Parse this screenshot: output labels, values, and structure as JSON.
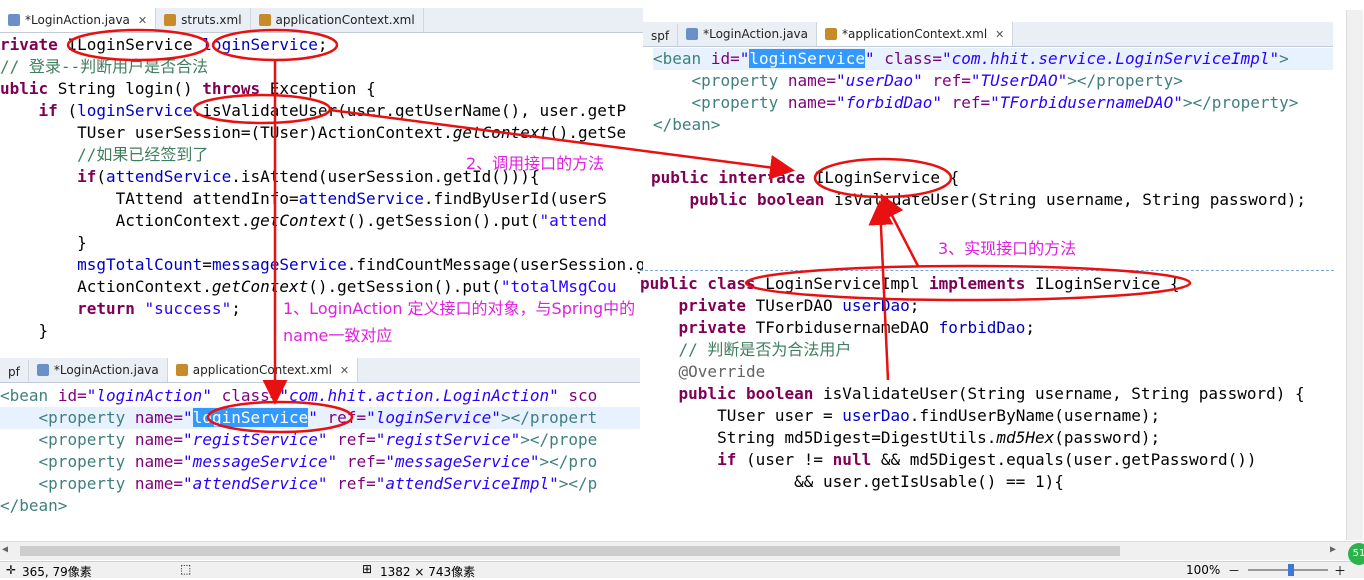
{
  "left_editor": {
    "tabs": [
      {
        "label": "*LoginAction.java",
        "close": "✕",
        "icon": "java-file-icon"
      },
      {
        "label": "struts.xml",
        "icon": "xml-file-icon"
      },
      {
        "label": "applicationContext.xml",
        "icon": "xml-file-icon"
      }
    ],
    "lines": [
      [
        [
          "rivate ",
          "kw"
        ],
        [
          "ILoginService ",
          ""
        ],
        [
          "loginService",
          "fd"
        ],
        [
          ";",
          ""
        ]
      ],
      [
        [
          "// 登录--判断用户是否合法",
          "cm"
        ]
      ],
      [
        [
          "ublic ",
          "kw"
        ],
        [
          "String login() ",
          ""
        ],
        [
          "throws ",
          "kw"
        ],
        [
          "Exception {",
          ""
        ]
      ],
      [
        [
          "    if ",
          "kw"
        ],
        [
          "(",
          ""
        ],
        [
          "loginService",
          "fd"
        ],
        [
          ".isValidateUser(user.getUserName(), user.getP",
          ""
        ]
      ],
      [
        [
          "        TUser userSession=(TUser)ActionContext.",
          ""
        ],
        [
          "getContext",
          "it"
        ],
        [
          "().getSe",
          ""
        ]
      ],
      [
        [
          "        //如果已经签到了",
          "cm"
        ]
      ],
      [
        [
          "        if",
          "kw"
        ],
        [
          "(",
          ""
        ],
        [
          "attendService",
          "fd"
        ],
        [
          ".isAttend(userSession.getId())){",
          ""
        ]
      ],
      [
        [
          "            TAttend attendInfo=",
          ""
        ],
        [
          "attendService",
          "fd"
        ],
        [
          ".findByUserId(userS",
          ""
        ]
      ],
      [
        [
          "            ActionContext.",
          ""
        ],
        [
          "getContext",
          "it"
        ],
        [
          "().getSession().put(",
          ""
        ],
        [
          "\"attend",
          "st"
        ]
      ],
      [
        [
          "        }",
          ""
        ]
      ],
      [
        [
          "        ",
          ""
        ],
        [
          "msgTotalCount",
          "fd"
        ],
        [
          "=",
          ""
        ],
        [
          "messageService",
          "fd"
        ],
        [
          ".findCountMessage(userSession.getRealName(",
          ""
        ]
      ],
      [
        [
          "        ActionContext.",
          ""
        ],
        [
          "getContext",
          "it"
        ],
        [
          "().getSession().put(",
          ""
        ],
        [
          "\"totalMsgCou",
          "st"
        ]
      ],
      [
        [
          "        return ",
          "kw"
        ],
        [
          "\"success\"",
          "st"
        ],
        [
          ";",
          ""
        ]
      ],
      [
        [
          "    }",
          ""
        ]
      ]
    ]
  },
  "bottom_left_editor": {
    "tabs": [
      {
        "label": "pf",
        "icon": ""
      },
      {
        "label": "*LoginAction.java",
        "icon": "java-file-icon"
      },
      {
        "label": "applicationContext.xml",
        "close": "✕",
        "icon": "xml-file-icon"
      }
    ],
    "lines": [
      [
        [
          "<",
          "tag"
        ],
        [
          "bean ",
          "tag"
        ],
        [
          "id=",
          "an"
        ],
        [
          "\"loginAction\" ",
          "av"
        ],
        [
          "class=",
          "an"
        ],
        [
          "\"com.hhit.action.LoginAction\" ",
          "av"
        ],
        [
          "sco",
          "an"
        ]
      ],
      [
        [
          "    <",
          "tag"
        ],
        [
          "property ",
          "tag"
        ],
        [
          "name=",
          "an"
        ],
        [
          "\"",
          "av"
        ],
        [
          "loginService",
          "sel"
        ],
        [
          "\" ",
          "av"
        ],
        [
          "ref=",
          "an"
        ],
        [
          "\"loginService\"",
          "av"
        ],
        [
          "></",
          "tag"
        ],
        [
          "propert",
          "tag"
        ]
      ],
      [
        [
          "    <",
          "tag"
        ],
        [
          "property ",
          "tag"
        ],
        [
          "name=",
          "an"
        ],
        [
          "\"registService\" ",
          "av"
        ],
        [
          "ref=",
          "an"
        ],
        [
          "\"registService\"",
          "av"
        ],
        [
          "></prope",
          "tag"
        ]
      ],
      [
        [
          "    <",
          "tag"
        ],
        [
          "property ",
          "tag"
        ],
        [
          "name=",
          "an"
        ],
        [
          "\"messageService\" ",
          "av"
        ],
        [
          "ref=",
          "an"
        ],
        [
          "\"messageService\"",
          "av"
        ],
        [
          "></pro",
          "tag"
        ]
      ],
      [
        [
          "    <",
          "tag"
        ],
        [
          "property ",
          "tag"
        ],
        [
          "name=",
          "an"
        ],
        [
          "\"attendService\" ",
          "av"
        ],
        [
          "ref=",
          "an"
        ],
        [
          "\"attendServiceImpl\"",
          "av"
        ],
        [
          "></p",
          "tag"
        ]
      ],
      [
        [
          "</",
          "tag"
        ],
        [
          "bean",
          "tag"
        ],
        [
          ">",
          "tag"
        ]
      ]
    ]
  },
  "right_xml_editor": {
    "tabs": [
      {
        "label": "spf",
        "icon": ""
      },
      {
        "label": "*LoginAction.java",
        "icon": "java-file-icon"
      },
      {
        "label": "*applicationContext.xml",
        "close": "✕",
        "icon": "xml-file-icon"
      }
    ],
    "lines": [
      [
        [
          "<",
          "tag"
        ],
        [
          "bean ",
          "tag"
        ],
        [
          "id=",
          "an"
        ],
        [
          "\"",
          "av"
        ],
        [
          "loginService",
          "sel"
        ],
        [
          "\" ",
          "av"
        ],
        [
          "class=",
          "an"
        ],
        [
          "\"com.hhit.service.LoginServiceImpl\"",
          "av"
        ],
        [
          ">",
          "tag"
        ]
      ],
      [
        [
          "    <",
          "tag"
        ],
        [
          "property ",
          "tag"
        ],
        [
          "name=",
          "an"
        ],
        [
          "\"userDao\" ",
          "av"
        ],
        [
          "ref=",
          "an"
        ],
        [
          "\"TUserDAO\"",
          "av"
        ],
        [
          "></property>",
          "tag"
        ]
      ],
      [
        [
          "    <",
          "tag"
        ],
        [
          "property ",
          "tag"
        ],
        [
          "name=",
          "an"
        ],
        [
          "\"forbidDao\" ",
          "av"
        ],
        [
          "ref=",
          "an"
        ],
        [
          "\"TForbidusernameDAO\"",
          "av"
        ],
        [
          "></property>",
          "tag"
        ]
      ],
      [
        [
          "</",
          "tag"
        ],
        [
          "bean",
          "tag"
        ],
        [
          ">",
          "tag"
        ]
      ]
    ]
  },
  "interface_editor": {
    "lines": [
      [
        [
          "public interface ",
          "kw"
        ],
        [
          "ILoginService {",
          ""
        ]
      ],
      [
        [
          "    public boolean ",
          "kw"
        ],
        [
          "isValidateUser(String username, String password);",
          ""
        ]
      ]
    ]
  },
  "impl_editor": {
    "lines": [
      [
        [
          "public class ",
          "kw"
        ],
        [
          "LoginServiceImpl ",
          ""
        ],
        [
          "implements ",
          "kw"
        ],
        [
          "ILoginService {",
          ""
        ]
      ],
      [
        [
          "    private ",
          "kw"
        ],
        [
          "TUserDAO ",
          ""
        ],
        [
          "userDao",
          "fd"
        ],
        [
          ";",
          ""
        ]
      ],
      [
        [
          "    private ",
          "kw"
        ],
        [
          "TForbidusernameDAO ",
          ""
        ],
        [
          "forbidDao",
          "fd"
        ],
        [
          ";",
          ""
        ]
      ],
      [
        [
          "    // 判断是否为合法用户",
          "cm"
        ]
      ],
      [
        [
          "    @Override",
          "ann"
        ]
      ],
      [
        [
          "    public boolean ",
          "kw"
        ],
        [
          "isValidateUser(String username, String password) {",
          ""
        ]
      ],
      [
        [
          "        TUser user = ",
          ""
        ],
        [
          "userDao",
          "fd"
        ],
        [
          ".findUserByName(username);",
          ""
        ]
      ],
      [
        [
          "        String md5Digest=DigestUtils.",
          ""
        ],
        [
          "md5Hex",
          "it"
        ],
        [
          "(password);",
          ""
        ]
      ],
      [
        [
          "        if ",
          "kw"
        ],
        [
          "(user != ",
          ""
        ],
        [
          "null ",
          "kw"
        ],
        [
          "&& md5Digest.equals(user.getPassword())",
          ""
        ]
      ],
      [
        [
          "                && user.getIsUsable() == 1){",
          ""
        ]
      ]
    ]
  },
  "annotations": {
    "note1_line1": "1、LoginAction 定义接口的对象，与Spring中的",
    "note1_line2": "name一致对应",
    "note2": "2、调用接口的方法",
    "note3": "3、实现接口的方法"
  },
  "status_bar": {
    "cursor": "365, 79像素",
    "selection_size": "1382 × 743像素",
    "zoom": "100%"
  },
  "colors": {
    "annotation_red": "#e81010",
    "annotation_magenta": "#e020e0",
    "selection_blue": "#3399ff"
  }
}
